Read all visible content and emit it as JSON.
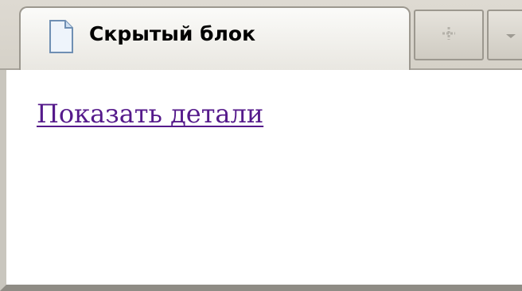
{
  "tab": {
    "title": "Скрытый блок",
    "icon": "document-icon"
  },
  "tab_buttons": {
    "new_tab_icon": "plus-icon",
    "menu_icon": "chevron-down-icon"
  },
  "content": {
    "link_text": "Показать детали"
  },
  "colors": {
    "visited_link": "#551a8b"
  }
}
